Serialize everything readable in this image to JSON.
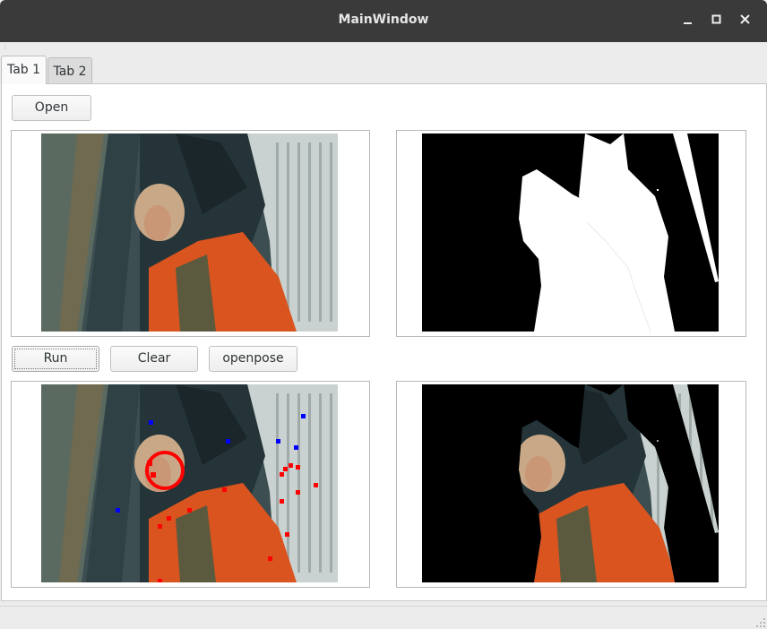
{
  "window": {
    "title": "MainWindow"
  },
  "tabs": [
    {
      "label": "Tab 1"
    },
    {
      "label": "Tab 2"
    }
  ],
  "buttons": {
    "open": "Open",
    "run": "Run",
    "clear": "Clear",
    "openpose": "openpose"
  },
  "colors": {
    "titlebar": "#3a3a3a",
    "jacket": "#d9541e",
    "keypoint_red": "#ff0000",
    "keypoint_blue": "#0000ff"
  }
}
